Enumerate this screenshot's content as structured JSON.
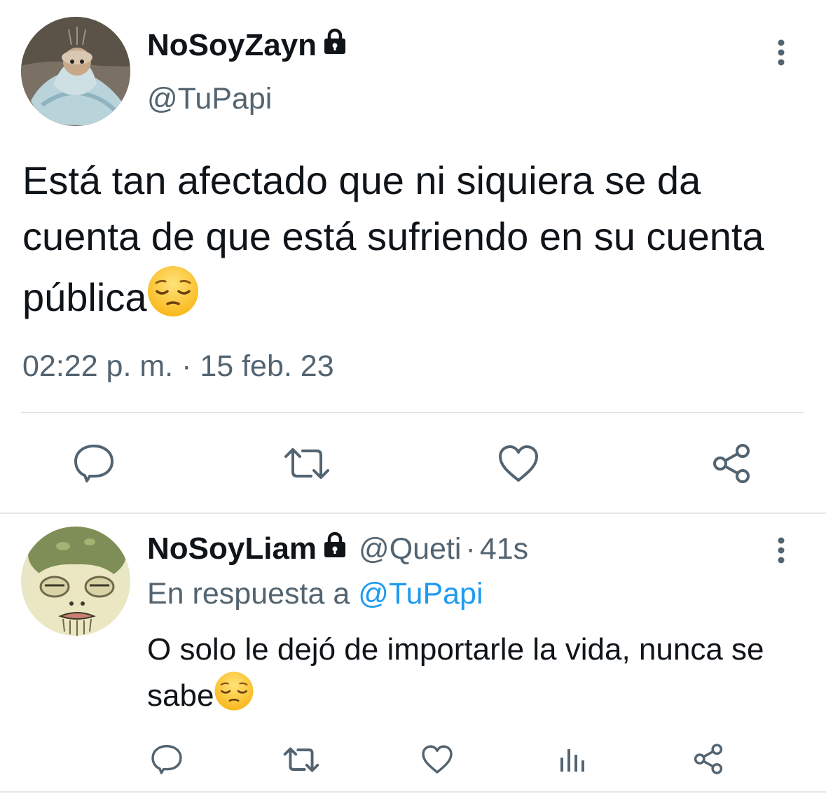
{
  "main_tweet": {
    "display_name": "NoSoyZayn",
    "handle": "@TuPapi",
    "text": "Está tan afectado que ni siquiera se da cuenta de que está sufriendo en su cuenta pública",
    "timestamp": "02:22 p. m. · 15 feb. 23",
    "actions": [
      "reply-icon",
      "retweet-icon",
      "like-icon",
      "share-icon"
    ]
  },
  "reply": {
    "display_name": "NoSoyLiam",
    "handle": "@Queti",
    "separator": "·",
    "time": "41s",
    "replying_prefix": "En respuesta a ",
    "replying_to": "@TuPapi",
    "text": "O solo le dejó de importarle la vida, nunca se sabe",
    "actions": [
      "reply-icon",
      "retweet-icon",
      "like-icon",
      "analytics-icon",
      "share-icon"
    ]
  },
  "colors": {
    "text": "#0f1419",
    "secondary": "#536471",
    "link": "#1d9bf0",
    "divider": "#e3e7ea",
    "icon": "#536471"
  }
}
